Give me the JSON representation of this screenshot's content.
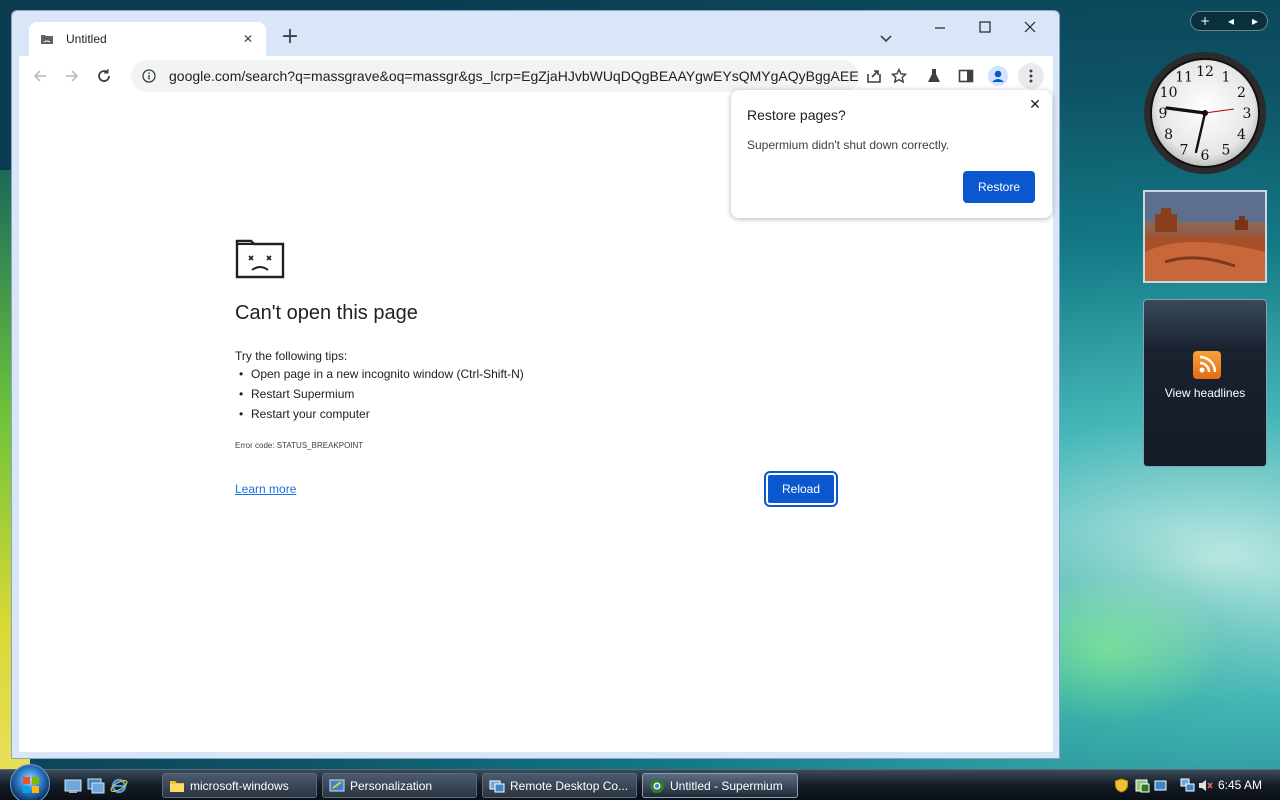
{
  "browser": {
    "tab": {
      "title": "Untitled"
    },
    "address": "google.com/search?q=massgrave&oq=massgr&gs_lcrp=EgZjaHJvbWUqDQgBEAAYgwEYsQMYgAQyBggAEEUY..."
  },
  "error_page": {
    "title": "Can't open this page",
    "tips_heading": "Try the following tips:",
    "tips": [
      "Open page in a new incognito window (Ctrl-Shift-N)",
      "Restart Supermium",
      "Restart your computer"
    ],
    "error_code": "Error code: STATUS_BREAKPOINT",
    "learn_more": "Learn more",
    "reload_label": "Reload"
  },
  "restore_dialog": {
    "title": "Restore pages?",
    "message": "Supermium didn't shut down correctly.",
    "button_label": "Restore"
  },
  "sidebar": {
    "clock_numbers": [
      "12",
      "1",
      "2",
      "3",
      "4",
      "5",
      "6",
      "7",
      "8",
      "9",
      "10",
      "11"
    ],
    "feeds_label": "View headlines"
  },
  "taskbar": {
    "tasks": [
      {
        "label": "microsoft-windows",
        "icon": "folder-icon"
      },
      {
        "label": "Personalization",
        "icon": "control-panel-icon"
      },
      {
        "label": "Remote Desktop Co...",
        "icon": "remote-desktop-icon"
      },
      {
        "label": "Untitled - Supermium",
        "icon": "supermium-icon"
      }
    ],
    "time": "6:45 AM"
  },
  "colors": {
    "accent": "#0b57d0",
    "link": "#1a73e8",
    "tabstrip": "#d9e6f7"
  }
}
